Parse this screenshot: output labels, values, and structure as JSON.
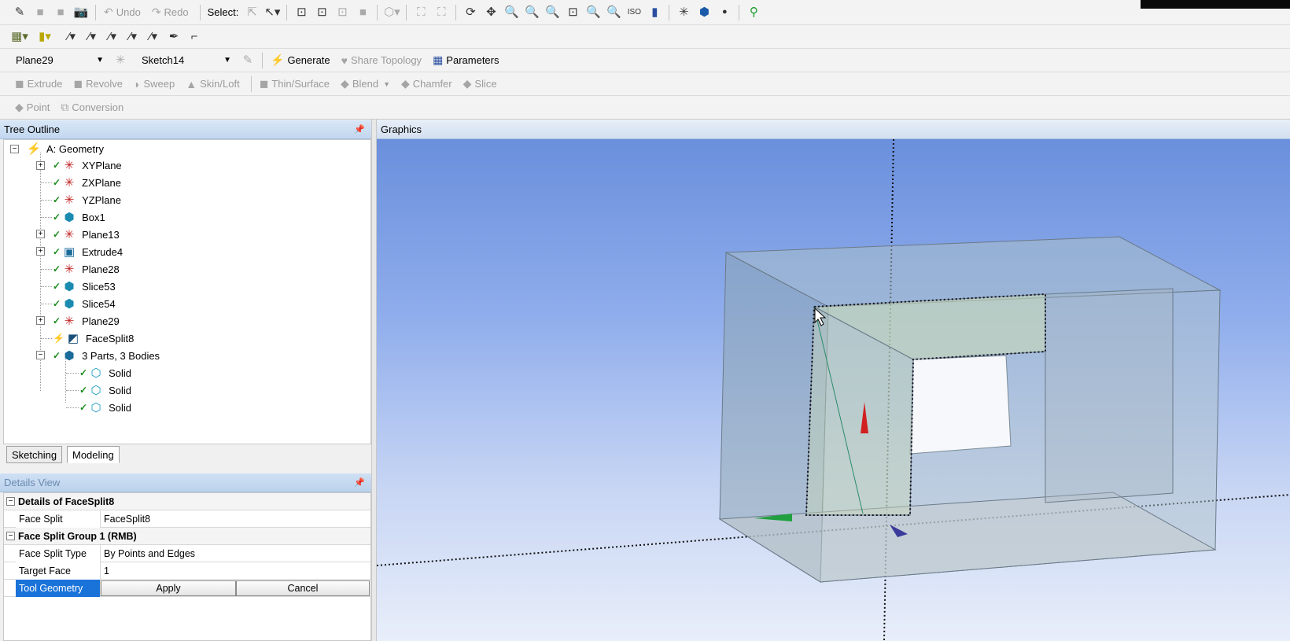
{
  "toolbar_select": {
    "label": "Select:"
  },
  "toolbar_undo": {
    "undo": "Undo",
    "redo": "Redo"
  },
  "plane_combo": {
    "value": "Plane29"
  },
  "sketch_combo": {
    "value": "Sketch14"
  },
  "actions": {
    "generate": "Generate",
    "share_topology": "Share Topology",
    "parameters": "Parameters"
  },
  "features": {
    "extrude": "Extrude",
    "revolve": "Revolve",
    "sweep": "Sweep",
    "skin_loft": "Skin/Loft",
    "thin_surface": "Thin/Surface",
    "blend": "Blend",
    "chamfer": "Chamfer",
    "slice": "Slice"
  },
  "features2": {
    "point": "Point",
    "conversion": "Conversion"
  },
  "panels": {
    "tree_outline": "Tree Outline",
    "graphics": "Graphics",
    "details_view": "Details View"
  },
  "tree": {
    "root": "A: Geometry",
    "items": [
      "XYPlane",
      "ZXPlane",
      "YZPlane",
      "Box1",
      "Plane13",
      "Extrude4",
      "Plane28",
      "Slice53",
      "Slice54",
      "Plane29",
      "FaceSplit8",
      "3 Parts, 3 Bodies"
    ],
    "bodies": [
      "Solid",
      "Solid",
      "Solid"
    ]
  },
  "tabs": {
    "sketching": "Sketching",
    "modeling": "Modeling"
  },
  "details": {
    "header": "Details of FaceSplit8",
    "face_split_label": "Face Split",
    "face_split_value": "FaceSplit8",
    "group": "Face Split Group 1  (RMB)",
    "type_label": "Face Split Type",
    "type_value": "By Points and Edges",
    "target_label": "Target Face",
    "target_value": "1",
    "tool_label": "Tool Geometry",
    "apply": "Apply",
    "cancel": "Cancel"
  },
  "colors": {
    "viewport_top": "#6a8fdc",
    "viewport_bottom": "#e8eefa",
    "selection": "#1a73d9",
    "check": "#1a8a1a"
  }
}
